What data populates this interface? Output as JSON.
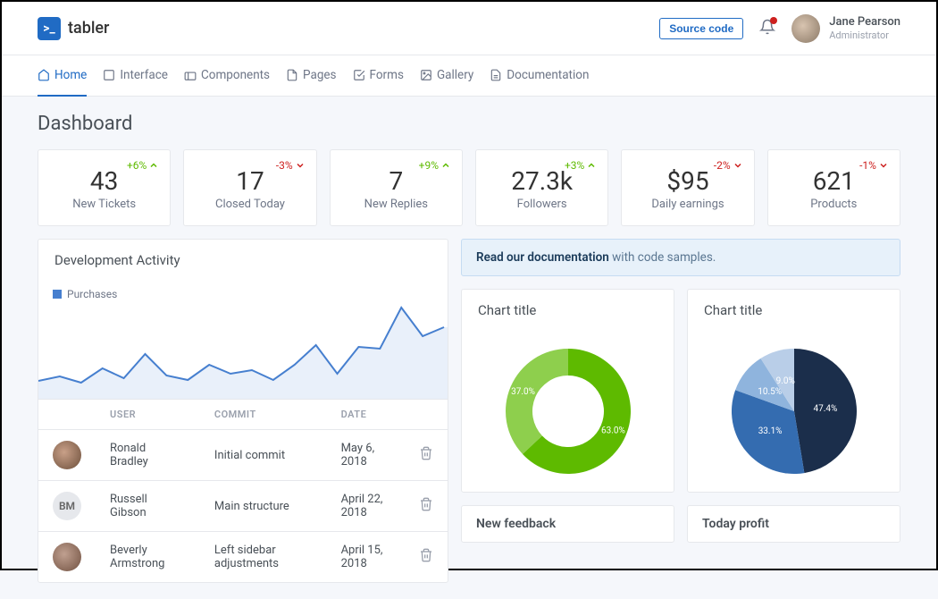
{
  "header": {
    "brand": "tabler",
    "source_btn": "Source code",
    "user_name": "Jane Pearson",
    "user_role": "Administrator"
  },
  "nav": [
    {
      "label": "Home",
      "active": true
    },
    {
      "label": "Interface"
    },
    {
      "label": "Components"
    },
    {
      "label": "Pages"
    },
    {
      "label": "Forms"
    },
    {
      "label": "Gallery"
    },
    {
      "label": "Documentation"
    }
  ],
  "page_title": "Dashboard",
  "stats": [
    {
      "delta": "+6%",
      "dir": "up",
      "value": "43",
      "label": "New Tickets"
    },
    {
      "delta": "-3%",
      "dir": "down",
      "value": "17",
      "label": "Closed Today"
    },
    {
      "delta": "+9%",
      "dir": "up",
      "value": "7",
      "label": "New Replies"
    },
    {
      "delta": "+3%",
      "dir": "up",
      "value": "27.3k",
      "label": "Followers"
    },
    {
      "delta": "-2%",
      "dir": "down",
      "value": "$95",
      "label": "Daily earnings"
    },
    {
      "delta": "-1%",
      "dir": "down",
      "value": "621",
      "label": "Products"
    }
  ],
  "dev_activity": {
    "title": "Development Activity",
    "legend": "Purchases",
    "table_headers": {
      "user": "USER",
      "commit": "COMMIT",
      "date": "DATE"
    },
    "rows": [
      {
        "avatar": "ronald",
        "initials": "",
        "user": "Ronald Bradley",
        "commit": "Initial commit",
        "date": "May 6, 2018"
      },
      {
        "avatar": "bm",
        "initials": "BM",
        "user": "Russell Gibson",
        "commit": "Main structure",
        "date": "April 22, 2018"
      },
      {
        "avatar": "beverly",
        "initials": "",
        "user": "Beverly Armstrong",
        "commit": "Left sidebar adjustments",
        "date": "April 15, 2018"
      }
    ]
  },
  "alert": {
    "bold": "Read our documentation",
    "rest": " with code samples."
  },
  "chart_card_title": "Chart title",
  "small_card1": "New feedback",
  "small_card2": "Today profit",
  "chart_data": [
    {
      "type": "pie",
      "variant": "donut",
      "title": "Chart title",
      "slices": [
        {
          "label": "63.0%",
          "value": 63.0,
          "color": "#5eba00"
        },
        {
          "label": "37.0%",
          "value": 37.0,
          "color": "#8ecf4d"
        }
      ]
    },
    {
      "type": "pie",
      "title": "Chart title",
      "slices": [
        {
          "label": "47.4%",
          "value": 47.4,
          "color": "#1b2e4b"
        },
        {
          "label": "33.1%",
          "value": 33.1,
          "color": "#346cb0"
        },
        {
          "label": "10.5%",
          "value": 10.5,
          "color": "#8fb4dd"
        },
        {
          "label": "9.0%",
          "value": 9.0,
          "color": "#b9cee8"
        }
      ]
    },
    {
      "type": "line",
      "title": "Development Activity",
      "series": [
        {
          "name": "Purchases",
          "values": [
            15,
            20,
            12,
            28,
            18,
            40,
            20,
            16,
            30,
            22,
            25,
            15,
            30,
            50,
            22,
            48,
            46,
            95,
            60,
            70
          ]
        }
      ],
      "ylim": [
        0,
        100
      ]
    }
  ]
}
